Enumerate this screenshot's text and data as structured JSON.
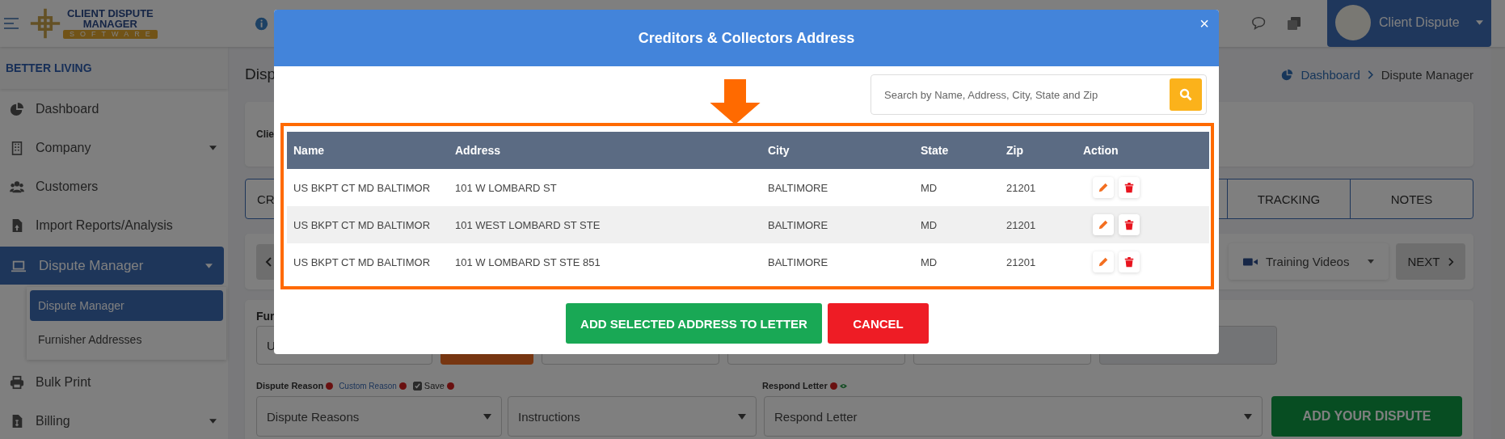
{
  "topbar": {
    "logo": {
      "line_1": "CLIENT DISPUTE",
      "line_2": "MANAGER",
      "line_3": "SOFTWARE"
    },
    "profile_name": "Client Dispute"
  },
  "sidebar": {
    "account": "BETTER LIVING",
    "items": [
      {
        "label": "Dashboard",
        "selected": false,
        "dropdown": false
      },
      {
        "label": "Company",
        "selected": false,
        "dropdown": true
      },
      {
        "label": "Customers",
        "selected": false,
        "dropdown": false
      },
      {
        "label": "Import Reports/Analysis",
        "selected": false,
        "dropdown": false
      },
      {
        "label": "Dispute Manager",
        "selected": true,
        "dropdown": true,
        "children": [
          {
            "label": "Dispute Manager",
            "selected": true
          },
          {
            "label": "Furnisher Addresses",
            "selected": false
          }
        ]
      },
      {
        "label": "Bulk Print",
        "selected": false,
        "dropdown": false
      },
      {
        "label": "Billing",
        "selected": false,
        "dropdown": true
      }
    ]
  },
  "main": {
    "page_title": "Disp",
    "breadcrumb": [
      "Dashboard",
      "Dispute Manager"
    ],
    "client_label": "Clie",
    "tabs": [
      "CR",
      "TRACKING",
      "NOTES"
    ],
    "toolbar": {
      "training_videos": "Training Videos",
      "next": "NEXT"
    },
    "form": {
      "furnisher_label": "Fur",
      "furnisher_value": "U",
      "dispute_reason_label": "Dispute Reason",
      "custom_reason_link": "Custom Reason",
      "save_label": "Save",
      "save_checked": true,
      "respond_letter_label": "Respond Letter",
      "selects": [
        "Dispute Reasons",
        "Instructions",
        "Respond Letter"
      ],
      "add_button": "ADD YOUR DISPUTE"
    }
  },
  "modal": {
    "title": "Creditors & Collectors Address",
    "close": "×",
    "search": {
      "placeholder": "Search by Name, Address, City, State and Zip"
    },
    "columns": [
      "Name",
      "Address",
      "City",
      "State",
      "Zip",
      "Action"
    ],
    "rows": [
      {
        "name": "US BKPT CT MD BALTIMOR",
        "address": "101 W LOMBARD ST",
        "city": "BALTIMORE",
        "state": "MD",
        "zip": "21201"
      },
      {
        "name": "US BKPT CT MD BALTIMOR",
        "address": "101 WEST LOMBARD ST STE",
        "city": "BALTIMORE",
        "state": "MD",
        "zip": "21201"
      },
      {
        "name": "US BKPT CT MD BALTIMOR",
        "address": "101 W LOMBARD ST STE 851",
        "city": "BALTIMORE",
        "state": "MD",
        "zip": "21201"
      }
    ],
    "buttons": {
      "add": "ADD SELECTED ADDRESS TO LETTER",
      "cancel": "CANCEL"
    }
  }
}
